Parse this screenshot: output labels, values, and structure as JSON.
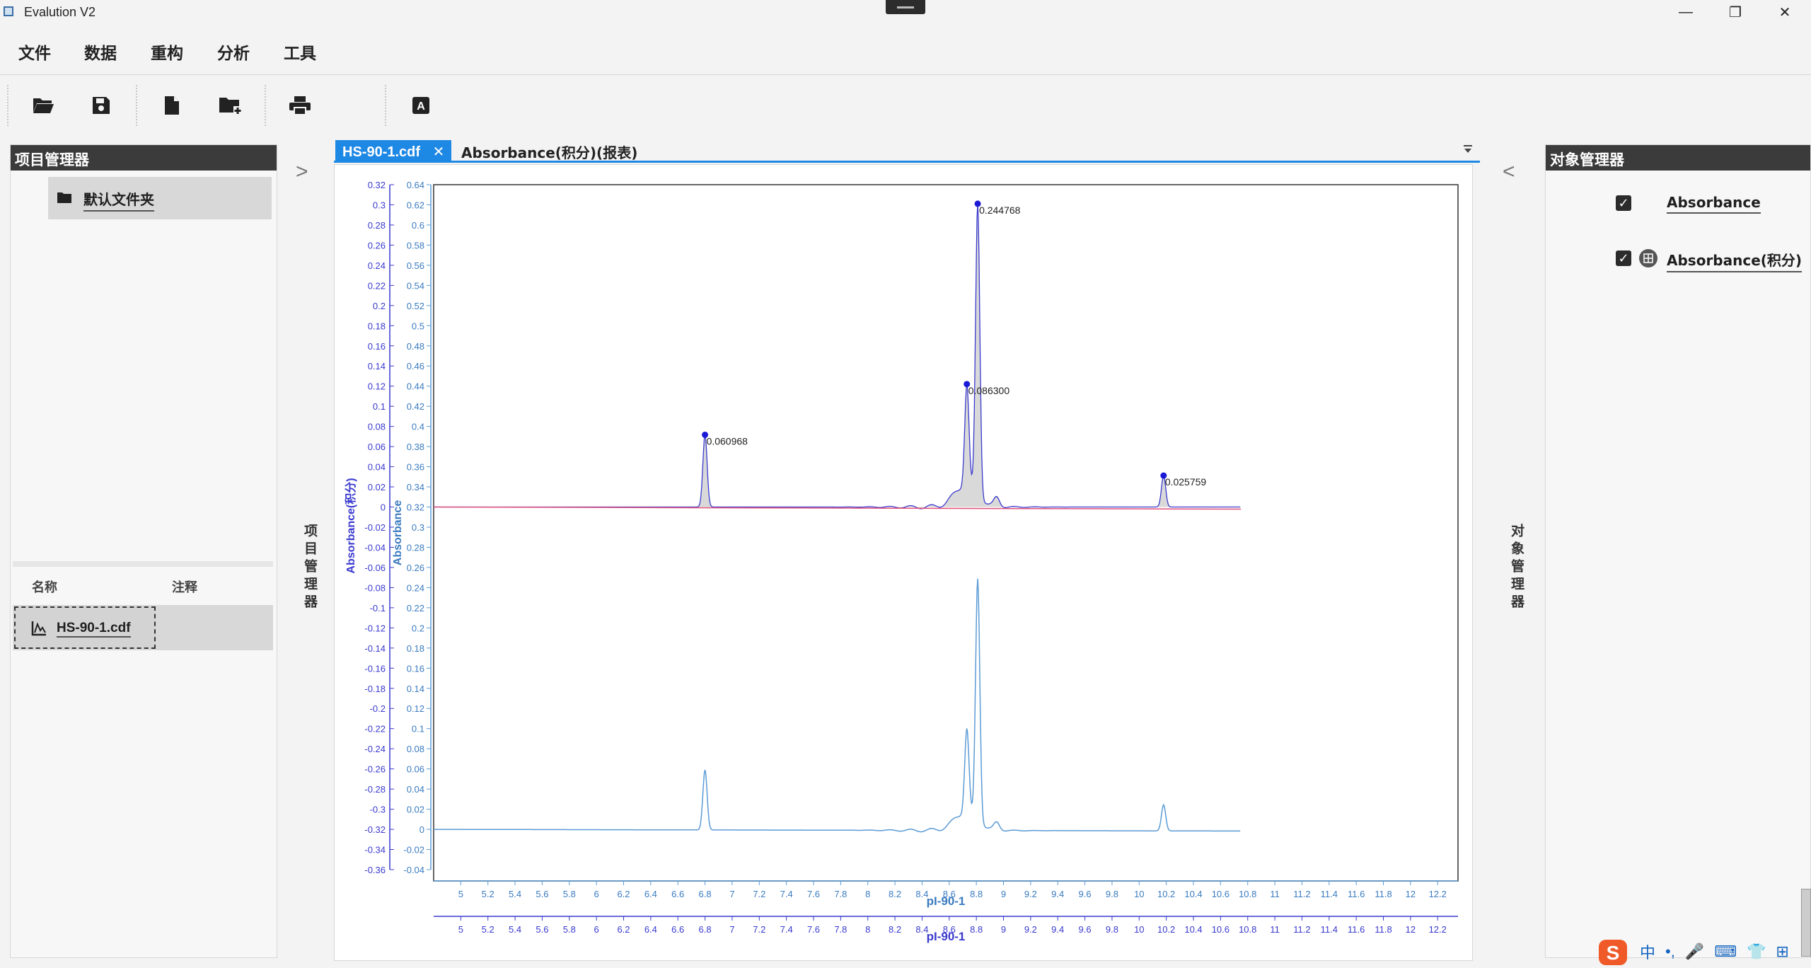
{
  "window": {
    "title": "Evalution V2",
    "minimize": "—",
    "maximize": "❐",
    "close": "✕"
  },
  "menu": [
    "文件",
    "数据",
    "重构",
    "分析",
    "工具"
  ],
  "toolbar": {
    "icons": [
      "open-folder-icon",
      "save-icon",
      "new-file-icon",
      "add-folder-icon",
      "print-icon",
      "font-icon"
    ]
  },
  "project_manager": {
    "title": "项目管理器",
    "folder": "默认文件夹",
    "columns": [
      "名称",
      "注释"
    ],
    "files": [
      {
        "name": "HS-90-1.cdf",
        "note": ""
      }
    ],
    "side_tab": "项目管理器",
    "collapse": ">"
  },
  "document": {
    "tabs": [
      {
        "label": "HS-90-1.cdf",
        "close": "✕",
        "active": true
      },
      {
        "label": "Absorbance(积分)(报表)",
        "active": false
      }
    ]
  },
  "object_manager": {
    "title": "对象管理器",
    "items": [
      {
        "label": "Absorbance",
        "checked": true
      },
      {
        "label": "Absorbance(积分)",
        "checked": true
      }
    ],
    "side_tab": "对象管理器",
    "collapse": "<"
  },
  "tray": [
    "中",
    "•,",
    "🎤",
    "⌨",
    "👕",
    "⊞"
  ],
  "chart_data": {
    "type": "line",
    "xlabel": "pI-90-1",
    "ylabel_left_outer": "Absorbance(积分)",
    "ylabel_left_inner": "Absorbance",
    "xlim": [
      4.8,
      12.35
    ],
    "x_ticks": [
      5,
      5.2,
      5.4,
      5.6,
      5.8,
      6,
      6.2,
      6.4,
      6.6,
      6.8,
      7,
      7.2,
      7.4,
      7.6,
      7.8,
      8,
      8.2,
      8.4,
      8.6,
      8.8,
      9,
      9.2,
      9.4,
      9.6,
      9.8,
      10,
      10.2,
      10.4,
      10.6,
      10.8,
      11,
      11.2,
      11.4,
      11.6,
      11.8,
      12,
      12.2
    ],
    "y_outer_ticks": [
      0.32,
      0.3,
      0.28,
      0.26,
      0.24,
      0.22,
      0.2,
      0.18,
      0.16,
      0.14,
      0.12,
      0.1,
      0.08,
      0.06,
      0.04,
      0.02,
      0,
      -0.02,
      -0.04,
      -0.06,
      -0.08,
      -0.1,
      -0.12,
      -0.14,
      -0.16,
      -0.18,
      -0.2,
      -0.22,
      -0.24,
      -0.26,
      -0.28,
      -0.3,
      -0.32,
      -0.34,
      -0.36
    ],
    "y_inner_ticks": [
      0.64,
      0.62,
      0.6,
      0.58,
      0.56,
      0.54,
      0.52,
      0.5,
      0.48,
      0.46,
      0.44,
      0.42,
      0.4,
      0.38,
      0.36,
      0.34,
      0.32,
      0.3,
      0.28,
      0.26,
      0.24,
      0.22,
      0.2,
      0.18,
      0.16,
      0.14,
      0.12,
      0.1,
      0.08,
      0.06,
      0.04,
      0.02,
      0,
      -0.02,
      -0.04
    ],
    "peaks": [
      {
        "x": 6.8,
        "label": "0.060968",
        "height": 0.062
      },
      {
        "x": 8.73,
        "label": "0.086300",
        "height": 0.088
      },
      {
        "x": 8.81,
        "label": "0.244768",
        "height": 0.25
      },
      {
        "x": 10.18,
        "label": "0.025759",
        "height": 0.027
      }
    ],
    "series": [
      {
        "name": "Absorbance(积分)",
        "color": "#3a3acf",
        "fill": "#d9d9d9"
      },
      {
        "name": "Absorbance",
        "color": "#5b9bd5"
      }
    ],
    "baseline_color": "#e0507a"
  }
}
